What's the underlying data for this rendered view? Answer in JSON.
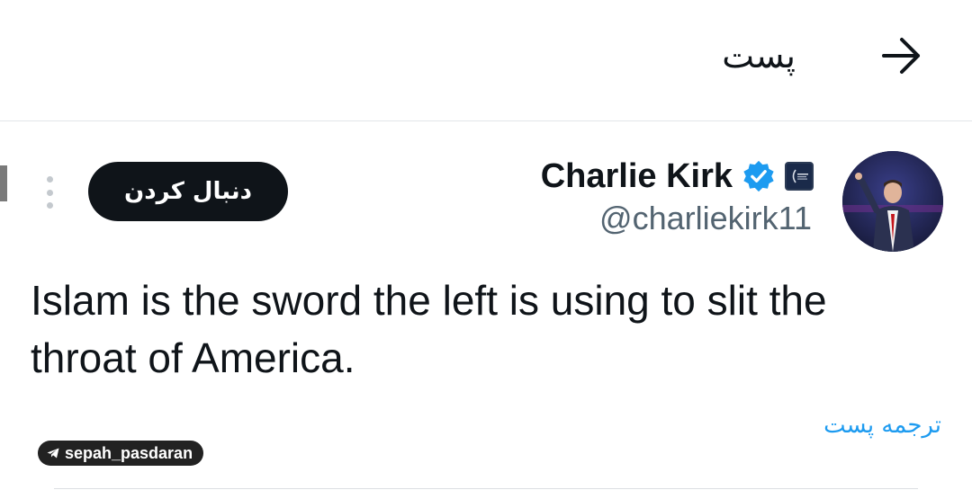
{
  "header": {
    "title": "پست",
    "back_icon": "arrow-right-icon"
  },
  "tweet": {
    "author": {
      "display_name": "Charlie Kirk",
      "handle": "@charliekirk11",
      "verified": true,
      "verified_color": "#1d9bf0",
      "affiliate_badge_icon": "organization-badge-icon"
    },
    "follow_label": "دنبال کردن",
    "more_icon": "more-vertical-icon",
    "text": "Islam is the sword the left is using to slit the throat of America.",
    "translate_label": "ترجمه پست"
  },
  "watermark": {
    "text": "sepah_pasdaran",
    "icon": "telegram-icon"
  },
  "colors": {
    "accent": "#1d9bf0",
    "text": "#0f1419",
    "secondary_text": "#536471",
    "button_bg": "#0f1419"
  }
}
